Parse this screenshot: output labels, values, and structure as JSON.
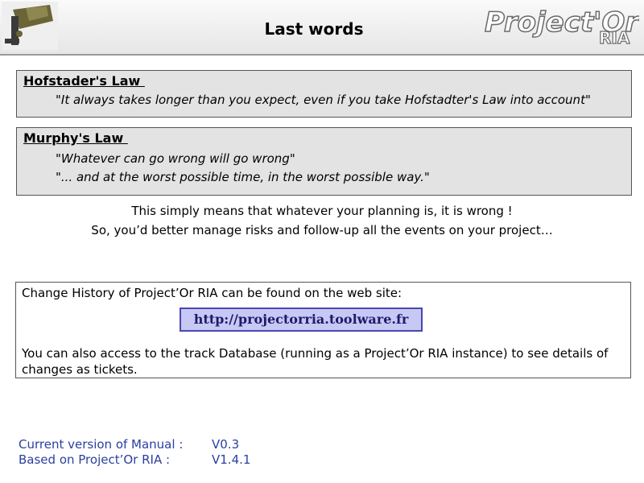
{
  "header": {
    "title": "Last words",
    "logo_text": "Project'Or",
    "logo_sub": "RIA",
    "left_icon": "security-camera-icon"
  },
  "laws": [
    {
      "title": "Hofstader's Law ",
      "quotes": [
        "\"It always takes longer than you expect, even if you take Hofstadter's Law into account\""
      ]
    },
    {
      "title": "Murphy's Law ",
      "quotes": [
        "\"Whatever can go wrong will go wrong\"",
        "\"... and at the worst possible time, in the worst possible way.\""
      ]
    }
  ],
  "conclusion": {
    "line1": "This simply means that whatever your planning is, it is wrong !",
    "line2": "So, you’d better manage risks and follow-up all the events on your project…"
  },
  "history": {
    "intro": "Change History of Project’Or RIA can be found on the web site:",
    "url": "http://projectorria.toolware.fr",
    "access": "You can also access to the track Database (running as a Project’Or RIA instance) to see details of changes as tickets."
  },
  "version_info": {
    "manual_label": "Current version of Manual :",
    "manual_value": "V0.3",
    "based_label": "Based on Project’Or RIA :",
    "based_value": "V1.4.1"
  },
  "colors": {
    "box_bg": "#e3e3e3",
    "url_bg": "#c8c8f4",
    "version_text": "#2b3fa0"
  }
}
